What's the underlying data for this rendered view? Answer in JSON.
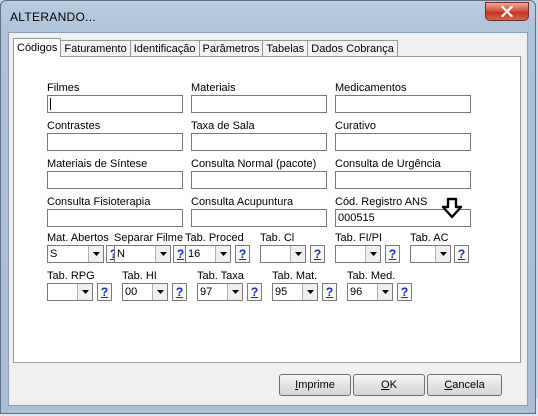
{
  "window": {
    "title": "ALTERANDO..."
  },
  "tabs": [
    {
      "label": "Códigos",
      "active": true
    },
    {
      "label": "Faturamento"
    },
    {
      "label": "Identificação"
    },
    {
      "label": "Parâmetros"
    },
    {
      "label": "Tabelas"
    },
    {
      "label": "Dados Cobrança"
    }
  ],
  "fields": {
    "filmes": {
      "label": "Filmes",
      "value": ""
    },
    "materiais": {
      "label": "Materiais",
      "value": ""
    },
    "medicamentos": {
      "label": "Medicamentos",
      "value": ""
    },
    "contrastes": {
      "label": "Contrastes",
      "value": ""
    },
    "taxa_sala": {
      "label": "Taxa de Sala",
      "value": ""
    },
    "curativo": {
      "label": "Curativo",
      "value": ""
    },
    "materiais_sintese": {
      "label": "Materiais de Síntese",
      "value": ""
    },
    "consulta_normal": {
      "label": "Consulta Normal (pacote)",
      "value": ""
    },
    "consulta_urgencia": {
      "label": "Consulta de Urgência",
      "value": ""
    },
    "consulta_fisioterapia": {
      "label": "Consulta Fisioterapia",
      "value": ""
    },
    "consulta_acupuntura": {
      "label": "Consulta Acupuntura",
      "value": ""
    },
    "cod_registro_ans": {
      "label": "Cód. Registro ANS",
      "value": "000515"
    }
  },
  "combos_row1": [
    {
      "label": "Mat. Abertos",
      "value": "S"
    },
    {
      "label": "Separar Filme",
      "value": "N"
    },
    {
      "label": "Tab. Proced",
      "value": "16"
    },
    {
      "label": "Tab. Cl",
      "value": ""
    },
    {
      "label": "Tab. FI/PI",
      "value": ""
    },
    {
      "label": "Tab. AC",
      "value": ""
    }
  ],
  "combos_row2": [
    {
      "label": "Tab. RPG",
      "value": ""
    },
    {
      "label": "Tab. HI",
      "value": "00"
    },
    {
      "label": "Tab. Taxa",
      "value": "97"
    },
    {
      "label": "Tab. Mat.",
      "value": "95"
    },
    {
      "label": "Tab. Med.",
      "value": "96"
    }
  ],
  "help_label": "?",
  "buttons": {
    "print": {
      "label": "Imprime",
      "underline": "I",
      "rest": "mprime"
    },
    "ok": {
      "label": "OK",
      "underline": "O",
      "rest": "K"
    },
    "cancel": {
      "label": "Cancela",
      "underline": "C",
      "rest": "ancela"
    }
  },
  "icons": {
    "close": "close-icon",
    "dropdown": "chevron-down-icon",
    "pointer": "down-arrow-icon"
  },
  "colors": {
    "help_text": "#1a26d6",
    "close_button": "#c0331f"
  }
}
